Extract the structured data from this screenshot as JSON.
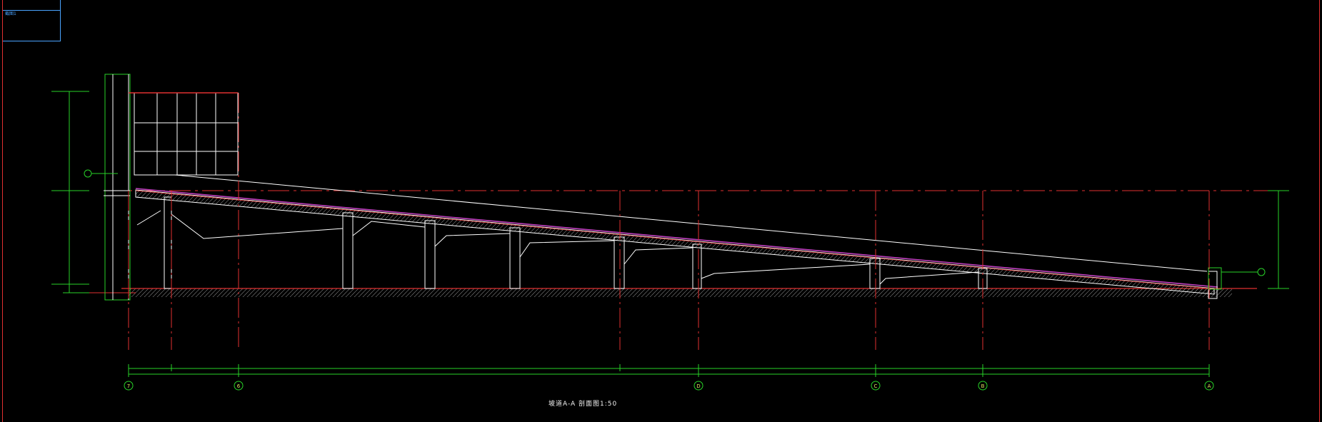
{
  "sheet": {
    "label": "截图1"
  },
  "drawing": {
    "title": "坡道A-A   剖面图1:50",
    "axes": [
      "7",
      "6",
      "D",
      "C",
      "B",
      "A"
    ],
    "colors": {
      "background": "#000000",
      "structure": "#ffffff",
      "dimension": "#28d228",
      "axis": "#e03030",
      "surface": "#c040c0",
      "ground": "#b05050",
      "sheet": "#4aa3ff"
    }
  }
}
